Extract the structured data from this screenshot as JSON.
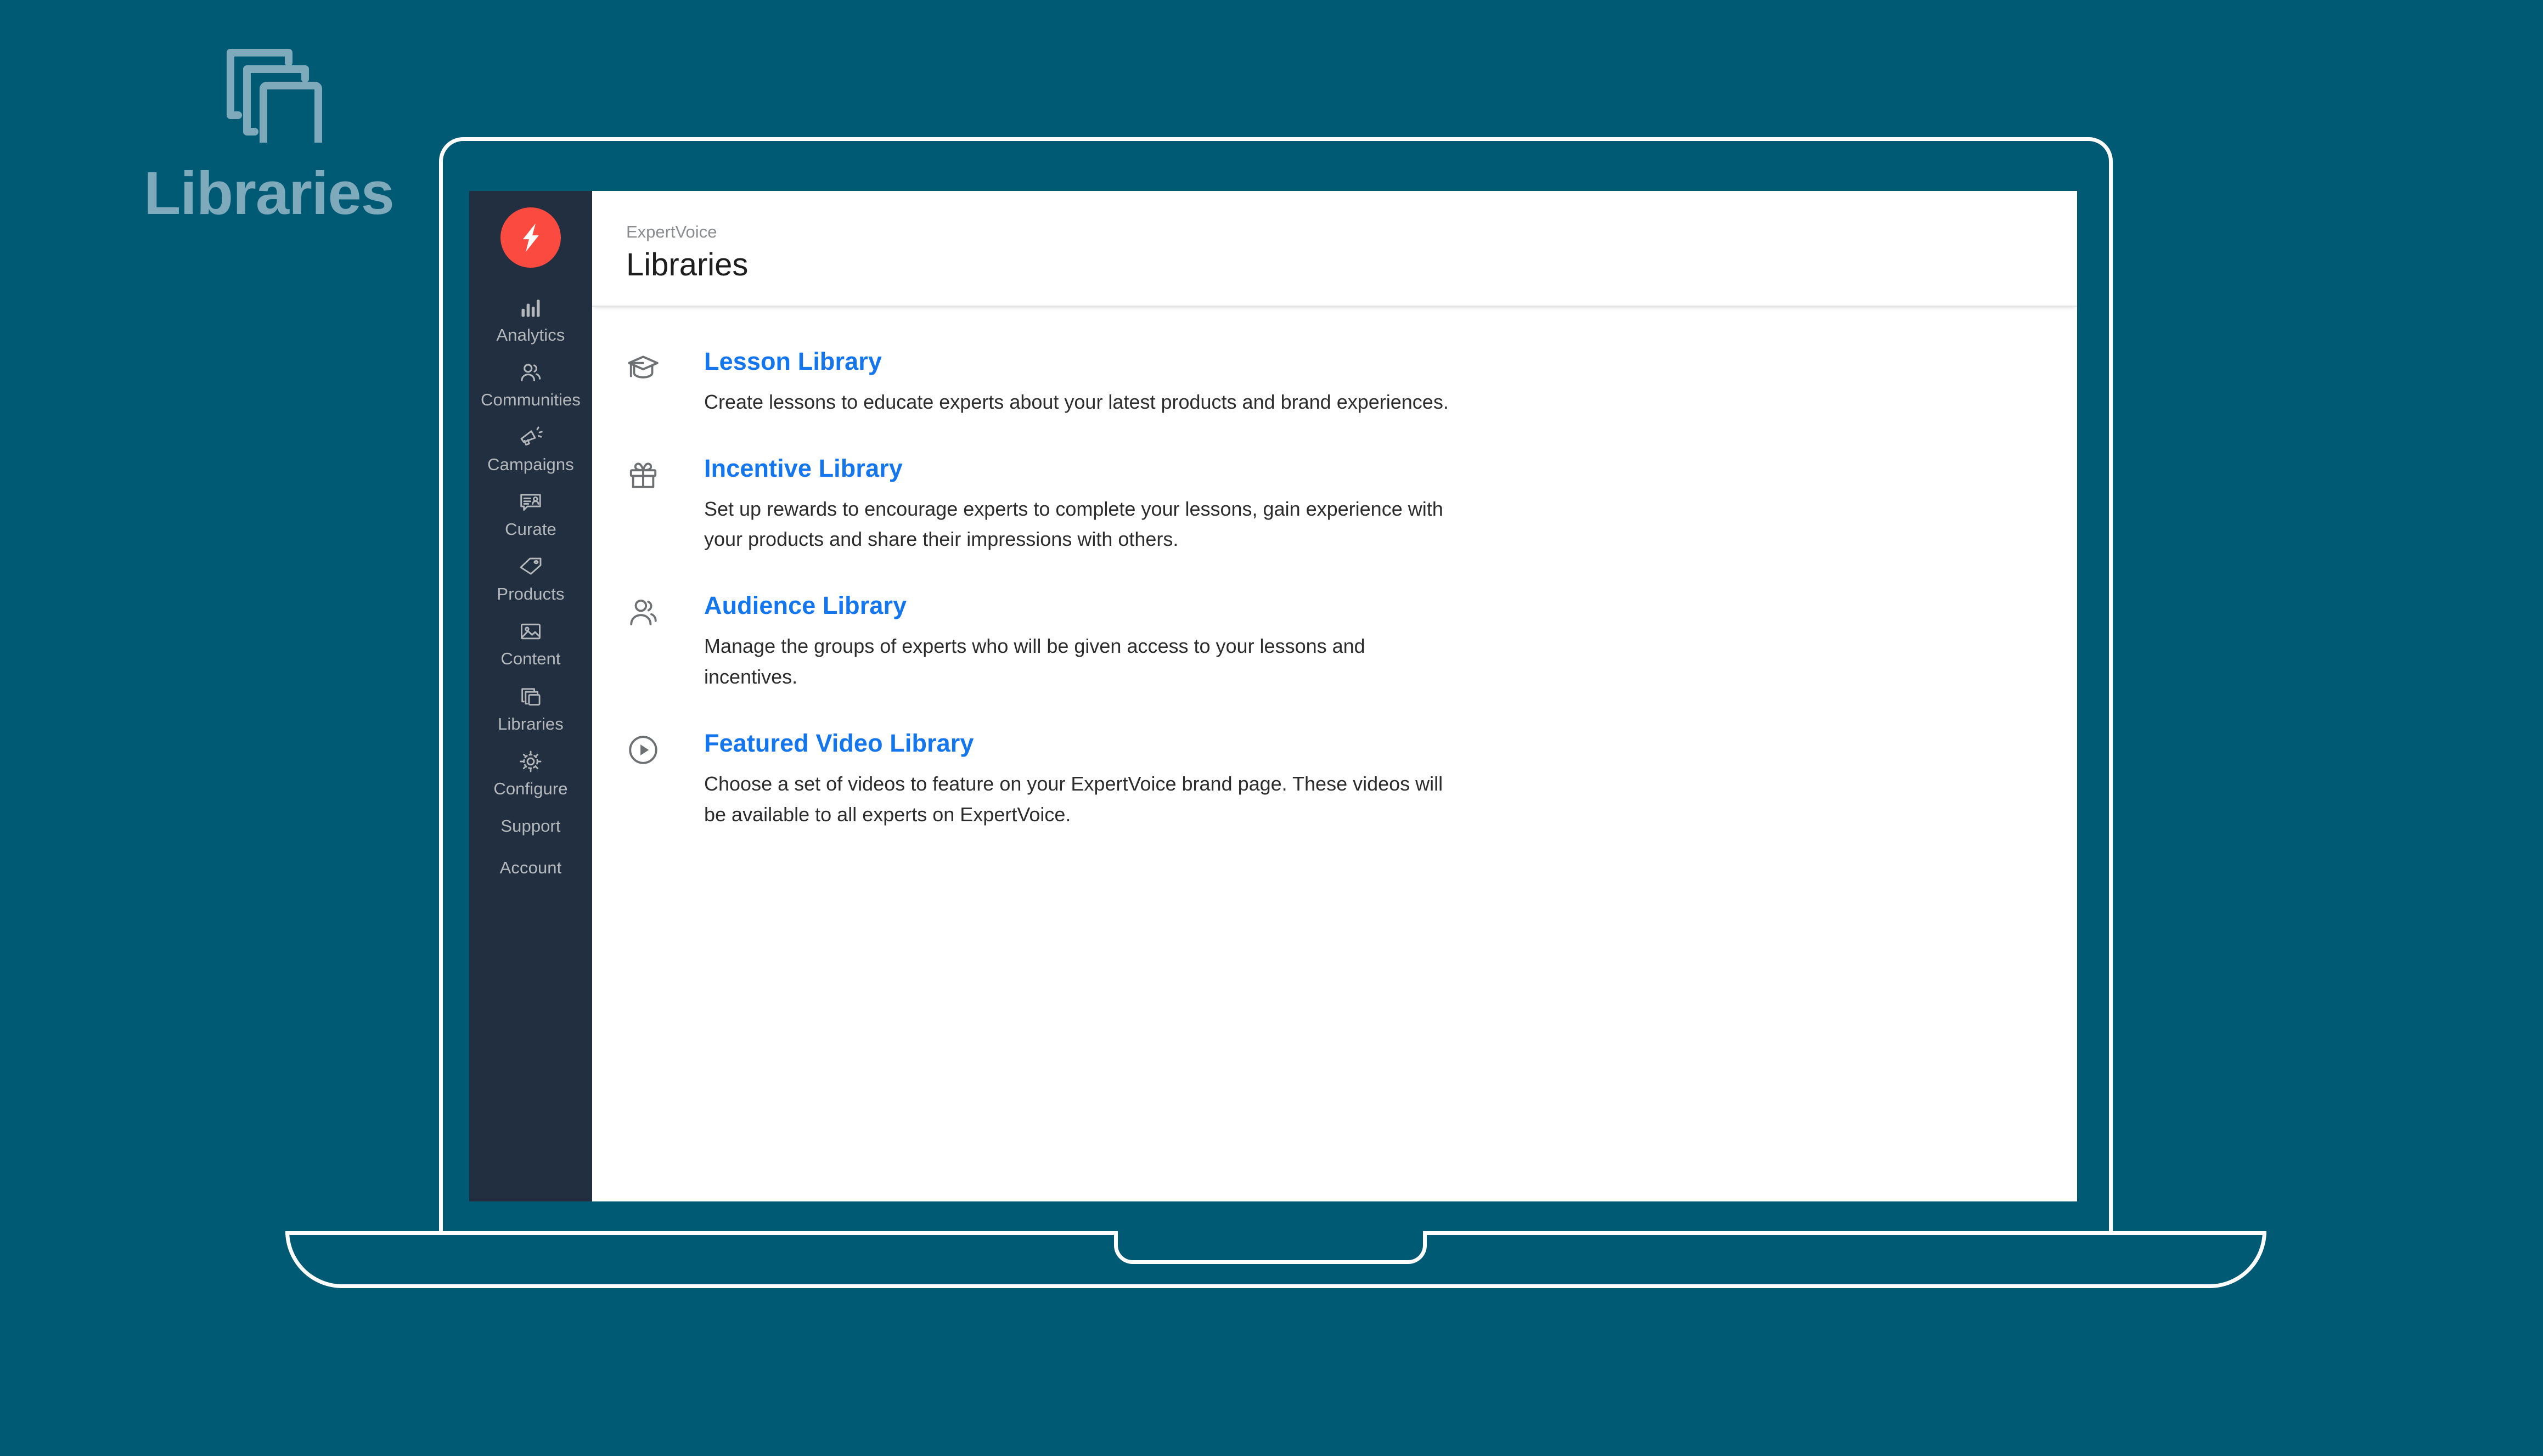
{
  "brand": {
    "label": "Libraries",
    "icon": "stacked-documents-icon",
    "accent_color": "#7EAABC"
  },
  "background_color": "#015A74",
  "app": {
    "logo_icon": "lightning-bolt-logo",
    "logo_background": "#FB4A3F",
    "sidebar_background": "#212F40",
    "link_color": "#1476EF"
  },
  "sidebar": {
    "items": [
      {
        "label": "Analytics",
        "icon": "bar-chart-icon"
      },
      {
        "label": "Communities",
        "icon": "people-icon"
      },
      {
        "label": "Campaigns",
        "icon": "megaphone-icon"
      },
      {
        "label": "Curate",
        "icon": "review-card-icon"
      },
      {
        "label": "Products",
        "icon": "tag-icon"
      },
      {
        "label": "Content",
        "icon": "image-icon"
      },
      {
        "label": "Libraries",
        "icon": "stacked-documents-icon"
      },
      {
        "label": "Configure",
        "icon": "gear-icon"
      },
      {
        "label": "Support",
        "icon": ""
      },
      {
        "label": "Account",
        "icon": ""
      }
    ]
  },
  "header": {
    "breadcrumb": "ExpertVoice",
    "title": "Libraries"
  },
  "main": {
    "libraries": [
      {
        "icon": "graduation-cap-icon",
        "title": "Lesson Library",
        "description": "Create lessons to educate experts about your latest products and brand experiences."
      },
      {
        "icon": "gift-icon",
        "title": "Incentive Library",
        "description": "Set up rewards to encourage experts to complete your lessons, gain experience with your products and share their impressions with others."
      },
      {
        "icon": "person-group-icon",
        "title": "Audience Library",
        "description": "Manage the groups of experts who will be given access to your lessons and incentives."
      },
      {
        "icon": "play-circle-icon",
        "title": "Featured Video Library",
        "description": "Choose a set of videos to feature on your ExpertVoice brand page. These videos will be available to all experts on ExpertVoice."
      }
    ]
  }
}
